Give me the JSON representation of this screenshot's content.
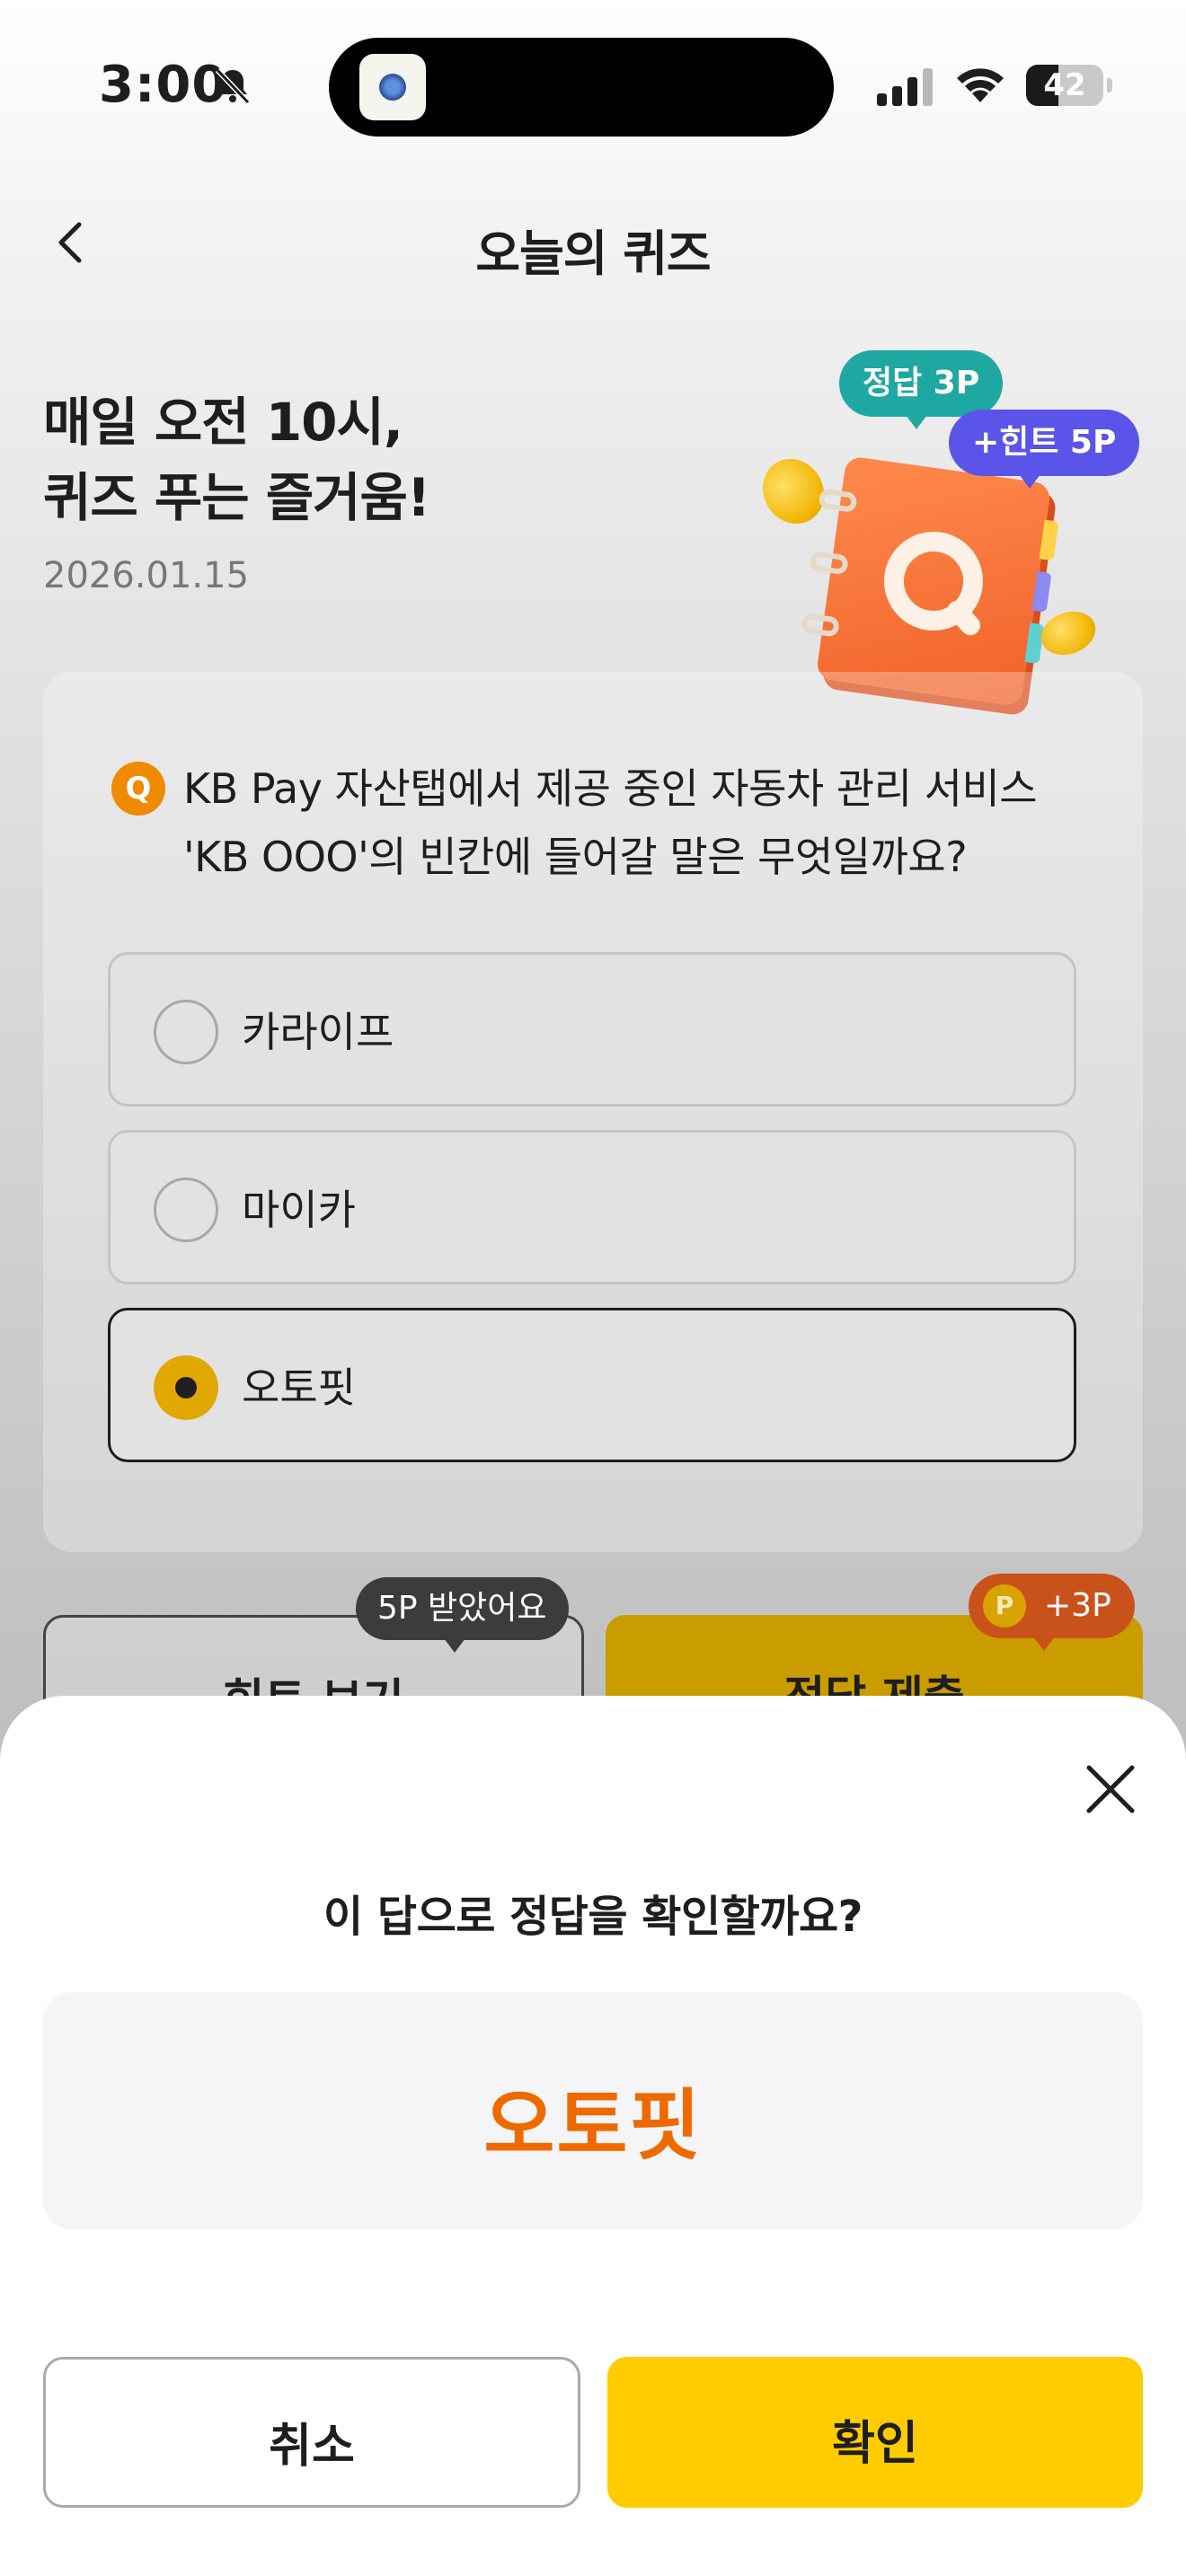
{
  "status_bar": {
    "time": "3:00",
    "battery_level": "42",
    "battery_fraction": 0.42
  },
  "nav": {
    "title": "오늘의 퀴즈"
  },
  "hero": {
    "title_line1": "매일 오전 10시,",
    "title_line2": "퀴즈 푸는 즐거움!",
    "date": "2026.01.15",
    "badge_answer": "정답 3P",
    "badge_hint": "+힌트 5P"
  },
  "question": {
    "badge": "Q",
    "line1": "KB Pay 자산탭에서 제공 중인 자동차 관리 서비스",
    "line2": "'KB OOO'의 빈칸에 들어갈 말은 무엇일까요?",
    "options": [
      {
        "label": "카라이프",
        "selected": false
      },
      {
        "label": "마이카",
        "selected": false
      },
      {
        "label": "오토핏",
        "selected": true
      }
    ]
  },
  "actions": {
    "hint_button": "힌트 보기",
    "submit_button": "정답 제출",
    "hint_tooltip": "5P 받았어요",
    "reward_tooltip": "+3P",
    "point_icon_letter": "P"
  },
  "sheet": {
    "title": "이 답으로 정답을 확인할까요?",
    "answer": "오토핏",
    "cancel_label": "취소",
    "confirm_label": "확인"
  },
  "colors": {
    "accent_yellow": "#ffcc00",
    "answer_orange": "#ee6a00",
    "answer_badge_teal": "#1fa8a2",
    "hint_badge_purple": "#5a55e8"
  },
  "icons": {
    "back": "chevron-left-icon",
    "close": "close-icon",
    "bell": "bell-slash-icon",
    "signal": "signal-icon",
    "wifi": "wifi-icon",
    "battery": "battery-icon"
  }
}
